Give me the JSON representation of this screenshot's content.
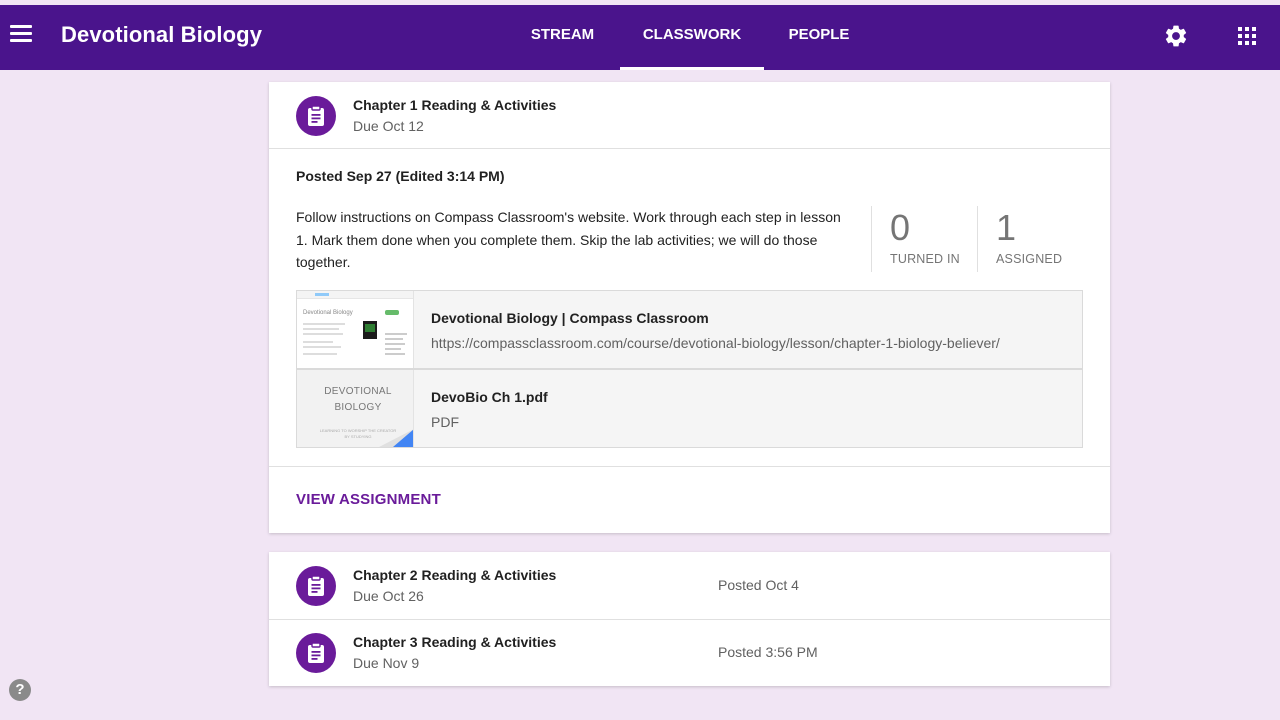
{
  "header": {
    "title": "Devotional Biology",
    "tabs": [
      {
        "label": "STREAM",
        "active": false
      },
      {
        "label": "CLASSWORK",
        "active": true
      },
      {
        "label": "PEOPLE",
        "active": false
      }
    ],
    "icons": [
      "menu-icon",
      "settings-icon",
      "apps-icon"
    ]
  },
  "colors": {
    "header_bg": "#4a148c",
    "accent": "#6a1b9a",
    "page_bg": "#f1e5f4"
  },
  "assignment": {
    "title": "Chapter 1 Reading & Activities",
    "due": "Due Oct 12",
    "posted": "Posted Sep 27 (Edited 3:14 PM)",
    "description": "Follow instructions on Compass Classroom's website. Work through each step in lesson 1. Mark them done when you complete them. Skip the lab activities; we will do those together.",
    "stats": [
      {
        "value": "0",
        "label": "TURNED IN"
      },
      {
        "value": "1",
        "label": "ASSIGNED"
      }
    ],
    "attachments": [
      {
        "title": "Devotional Biology | Compass Classroom",
        "subtitle": "https://compassclassroom.com/course/devotional-biology/lesson/chapter-1-biology-believer/",
        "thumb_text": "Devotional Biology"
      },
      {
        "title": "DevoBio Ch 1.pdf",
        "subtitle": "PDF",
        "thumb_title": "DEVOTIONAL BIOLOGY",
        "thumb_sub": "LEARNING TO WORSHIP THE CREATOR BY STUDYING"
      }
    ],
    "action": "VIEW ASSIGNMENT"
  },
  "list": [
    {
      "title": "Chapter 2 Reading & Activities",
      "due": "Due Oct 26",
      "posted": "Posted Oct 4"
    },
    {
      "title": "Chapter 3 Reading & Activities",
      "due": "Due Nov 9",
      "posted": "Posted 3:56 PM"
    }
  ],
  "help": {
    "label": "?"
  }
}
